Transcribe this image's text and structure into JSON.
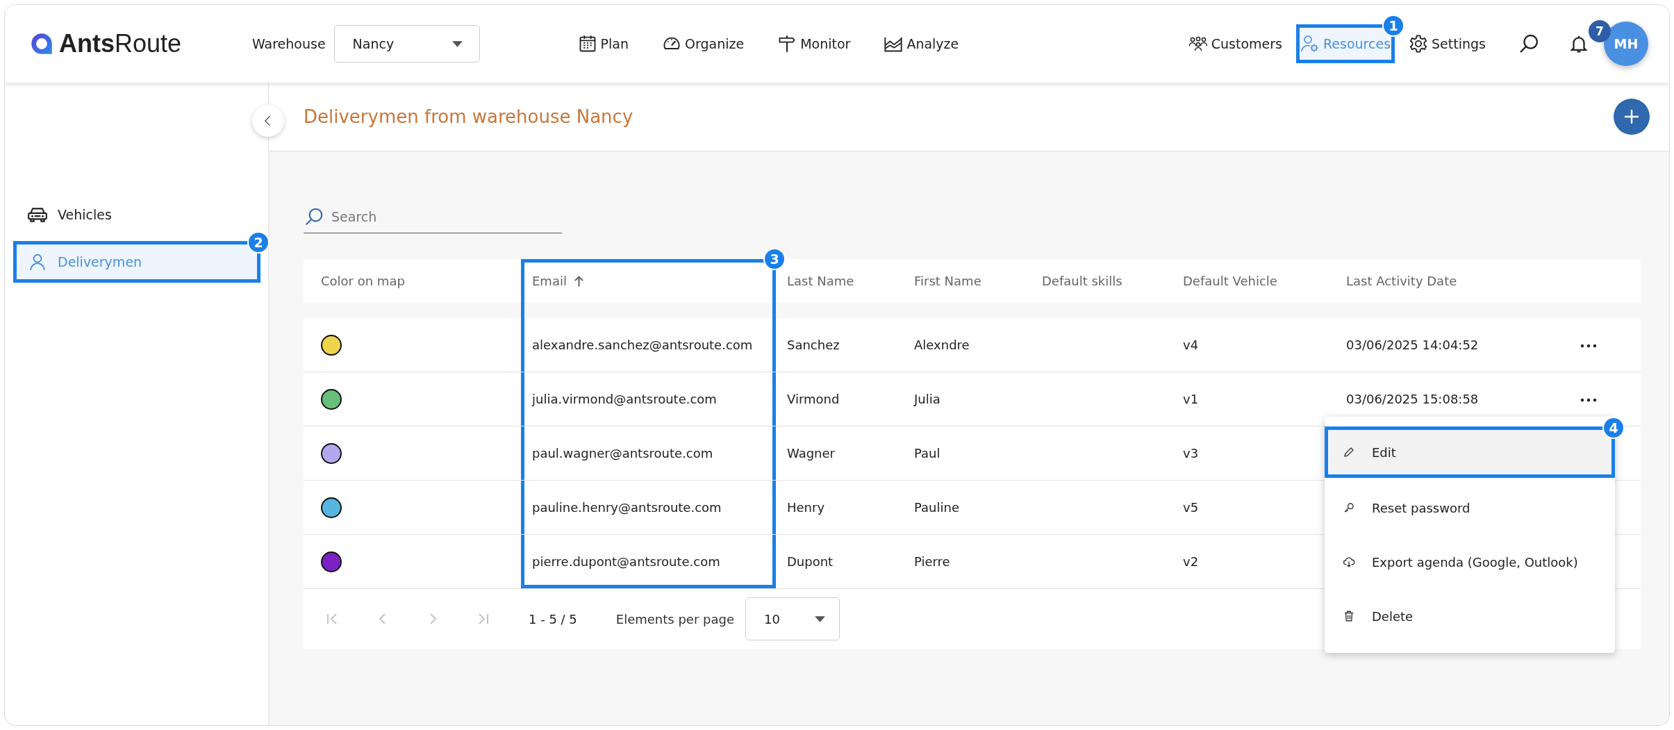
{
  "header": {
    "logo": "**Ants**Route",
    "warehouse_label": "Warehouse",
    "warehouse_value": "Nancy",
    "nav": [
      {
        "kind": "calendar",
        "label": "Plan"
      },
      {
        "kind": "gauge",
        "label": "Organize"
      },
      {
        "kind": "signpost",
        "label": "Monitor"
      },
      {
        "kind": "chart",
        "label": "Analyze"
      }
    ],
    "right_nav": [
      {
        "kind": "people",
        "label": "Customers",
        "selected": false
      },
      {
        "kind": "user-gear",
        "label": "Resources",
        "selected": true,
        "callout": "1"
      },
      {
        "kind": "gear",
        "label": "Settings",
        "selected": false
      }
    ],
    "notification_count": "7",
    "avatar_initials": "MH"
  },
  "sidebar": {
    "items": [
      {
        "kind": "car",
        "label": "Vehicles",
        "selected": false
      },
      {
        "kind": "person",
        "label": "Deliverymen",
        "selected": true,
        "callout": "2"
      }
    ]
  },
  "page_title": "Deliverymen from warehouse Nancy",
  "search": {
    "placeholder": "Search"
  },
  "table": {
    "columns": [
      {
        "label": "Color on map",
        "sorted": false
      },
      {
        "label": "Email",
        "sorted": true,
        "callout": "3"
      },
      {
        "label": "Last Name",
        "sorted": false
      },
      {
        "label": "First Name",
        "sorted": false
      },
      {
        "label": "Default skills",
        "sorted": false
      },
      {
        "label": "Default Vehicle",
        "sorted": false
      },
      {
        "label": "Last Activity Date",
        "sorted": false
      }
    ],
    "rows": [
      {
        "color": "#f0d44a",
        "email": "alexandre.sanchez@antsroute.com",
        "last_name": "Sanchez",
        "first_name": "Alexndre",
        "vehicle": "v4",
        "last_activity": "03/06/2025 14:04:52"
      },
      {
        "color": "#66c07a",
        "email": "julia.virmond@antsroute.com",
        "last_name": "Virmond",
        "first_name": "Julia",
        "vehicle": "v1",
        "last_activity": "03/06/2025 15:08:58"
      },
      {
        "color": "#b3a8ee",
        "email": "paul.wagner@antsroute.com",
        "last_name": "Wagner",
        "first_name": "Paul",
        "vehicle": "v3"
      },
      {
        "color": "#56b6e0",
        "email": "pauline.henry@antsroute.com",
        "last_name": "Henry",
        "first_name": "Pauline",
        "vehicle": "v5"
      },
      {
        "color": "#7b22c4",
        "email": "pierre.dupont@antsroute.com",
        "last_name": "Dupont",
        "first_name": "Pierre",
        "vehicle": "v2"
      }
    ]
  },
  "row_menu": {
    "items": [
      {
        "kind": "pencil",
        "label": "Edit",
        "selected": true,
        "callout": "4"
      },
      {
        "kind": "key",
        "label": "Reset password",
        "selected": false
      },
      {
        "kind": "cloud",
        "label": "Export agenda (Google, Outlook)",
        "selected": false
      },
      {
        "kind": "trash",
        "label": "Delete",
        "selected": false
      }
    ]
  },
  "pagination": {
    "buttons": [
      {
        "kind": "first",
        "disabled": true
      },
      {
        "kind": "prev",
        "disabled": true
      },
      {
        "kind": "next",
        "disabled": true
      },
      {
        "kind": "last",
        "disabled": true
      }
    ],
    "range": "1 - 5 / 5",
    "per_page_label": "Elements per page",
    "per_page_value": "10"
  }
}
